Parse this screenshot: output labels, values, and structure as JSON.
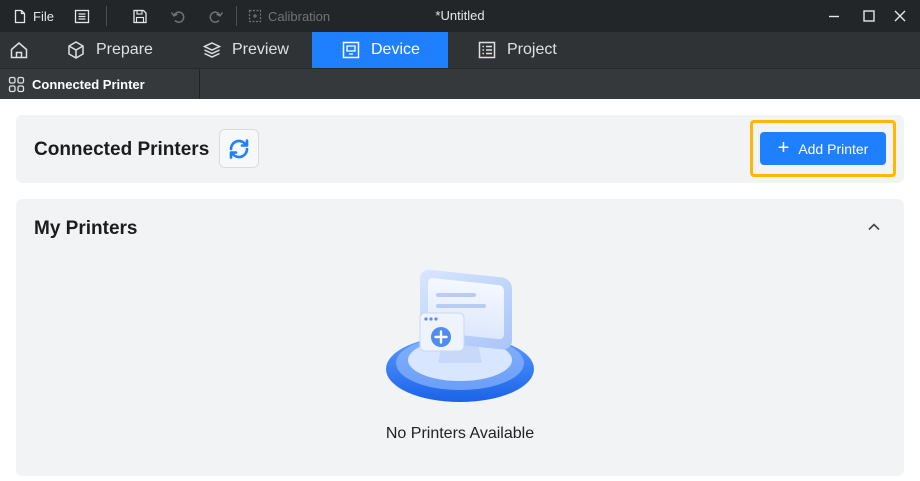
{
  "titlebar": {
    "file_label": "File",
    "calibration_label": "Calibration",
    "window_title": "*Untitled"
  },
  "tabs": [
    {
      "label": "Prepare"
    },
    {
      "label": "Preview"
    },
    {
      "label": "Device",
      "active": true
    },
    {
      "label": "Project"
    }
  ],
  "subtab": {
    "label": "Connected Printer"
  },
  "connected": {
    "title": "Connected Printers",
    "add_button_label": "Add Printer"
  },
  "my_printers": {
    "title": "My Printers",
    "empty_text": "No Printers Available"
  },
  "colors": {
    "accent": "#1e7fff",
    "highlight": "#ffb800",
    "titlebar_bg": "#232629",
    "tabbar_bg": "#303336"
  },
  "icons": {
    "home": "home-icon",
    "prepare": "cube-icon",
    "preview": "layers-icon",
    "device": "monitor-icon",
    "project": "list-icon",
    "refresh": "refresh-icon",
    "collapse": "chevron-up-icon"
  }
}
